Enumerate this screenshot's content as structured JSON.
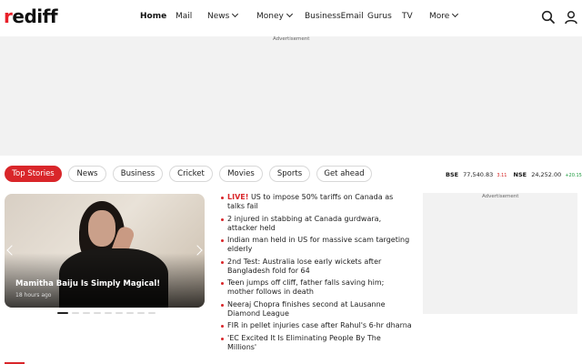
{
  "header": {
    "logo_prefix": "r",
    "logo_rest": "ediff",
    "nav": [
      {
        "label": "Home",
        "active": true
      },
      {
        "label": "Mail"
      },
      {
        "label": "News",
        "dropdown": true
      },
      {
        "label": "Money",
        "dropdown": true
      },
      {
        "label": "BusinessEmail"
      },
      {
        "label": "Gurus"
      },
      {
        "label": "TV"
      },
      {
        "label": "More",
        "dropdown": true
      }
    ],
    "icons": [
      "search-icon",
      "user-icon"
    ]
  },
  "ads": {
    "top_label": "Advertisement",
    "side_label": "Advertisement"
  },
  "tabs": [
    "Top Stories",
    "News",
    "Business",
    "Cricket",
    "Movies",
    "Sports",
    "Get ahead"
  ],
  "active_tab": "Top Stories",
  "ticker": {
    "bse_label": "BSE",
    "bse_value": "77,540.83",
    "bse_change": "3.11",
    "nse_label": "NSE",
    "nse_value": "24,252.00",
    "nse_change": "+20.15"
  },
  "carousel": {
    "title": "Mamitha Baiju Is Simply Magical!",
    "time": "18 hours ago",
    "slide_count": 10,
    "active_slide": 1
  },
  "headlines": [
    {
      "live": "LIVE!",
      "text": "US to impose 50% tariffs on Canada as talks fail"
    },
    {
      "text": "2 injured in stabbing at Canada gurdwara, attacker held"
    },
    {
      "text": "Indian man held in US for massive scam targeting elderly"
    },
    {
      "text": "2nd Test: Australia lose early wickets after Bangladesh fold for 64"
    },
    {
      "text": "Teen jumps off cliff, father falls saving him; mother follows in death"
    },
    {
      "text": "Neeraj Chopra finishes second at Lausanne Diamond League"
    },
    {
      "text": "FIR in pellet injuries case after Rahul's 6-hr dharna"
    },
    {
      "text": "'EC Excited It Is Eliminating People By The Millions'"
    }
  ],
  "colors": {
    "brand_red": "#d9262a",
    "up_green": "#1a9a3c",
    "down_red": "#d42020",
    "ad_gray": "#f2f2f2"
  }
}
